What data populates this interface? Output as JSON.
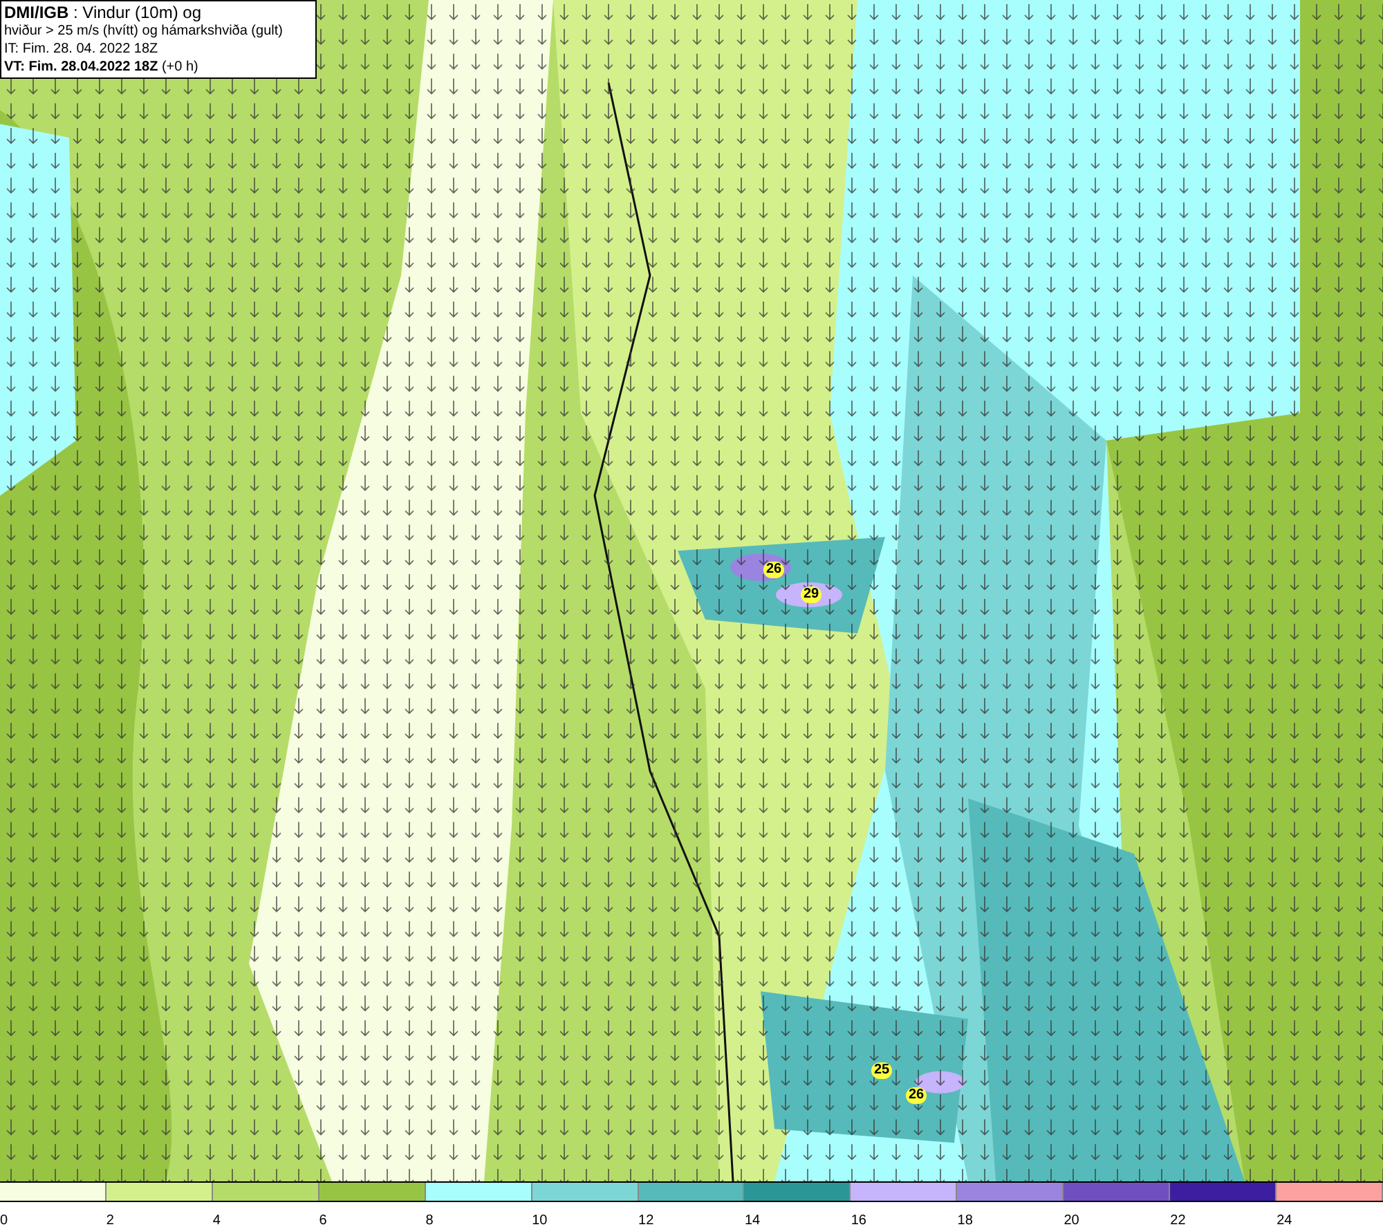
{
  "header": {
    "lines": [
      "**DMI/IGB** : Vindur (10m) og",
      "hviður > 25 m/s (hvítt) og hámarkshviða (gult)",
      "IT: Fim. 28. 04. 2022 18Z",
      "**VT: Fim. 28.04.2022 18Z** (+0 h)"
    ]
  },
  "map": {
    "maxima": [
      "26",
      "29",
      "25",
      "26"
    ]
  },
  "legend": {
    "bins": [
      {
        "color": "#f7fde0",
        "label": "0"
      },
      {
        "color": "#d4f08c",
        "label": "2"
      },
      {
        "color": "#b5dc68",
        "label": "4"
      },
      {
        "color": "#98c444",
        "label": "6"
      },
      {
        "color": "#a8fdfd",
        "label": "8"
      },
      {
        "color": "#7dd6d6",
        "label": "10"
      },
      {
        "color": "#56baba",
        "label": "12"
      },
      {
        "color": "#2a9696",
        "label": "14"
      },
      {
        "color": "#c6b4fc",
        "label": "16"
      },
      {
        "color": "#9a84e0",
        "label": "18"
      },
      {
        "color": "#7050c0",
        "label": "20"
      },
      {
        "color": "#3e1ea0",
        "label": "22"
      },
      {
        "color": "#fca0a0",
        "label": "24"
      }
    ]
  }
}
